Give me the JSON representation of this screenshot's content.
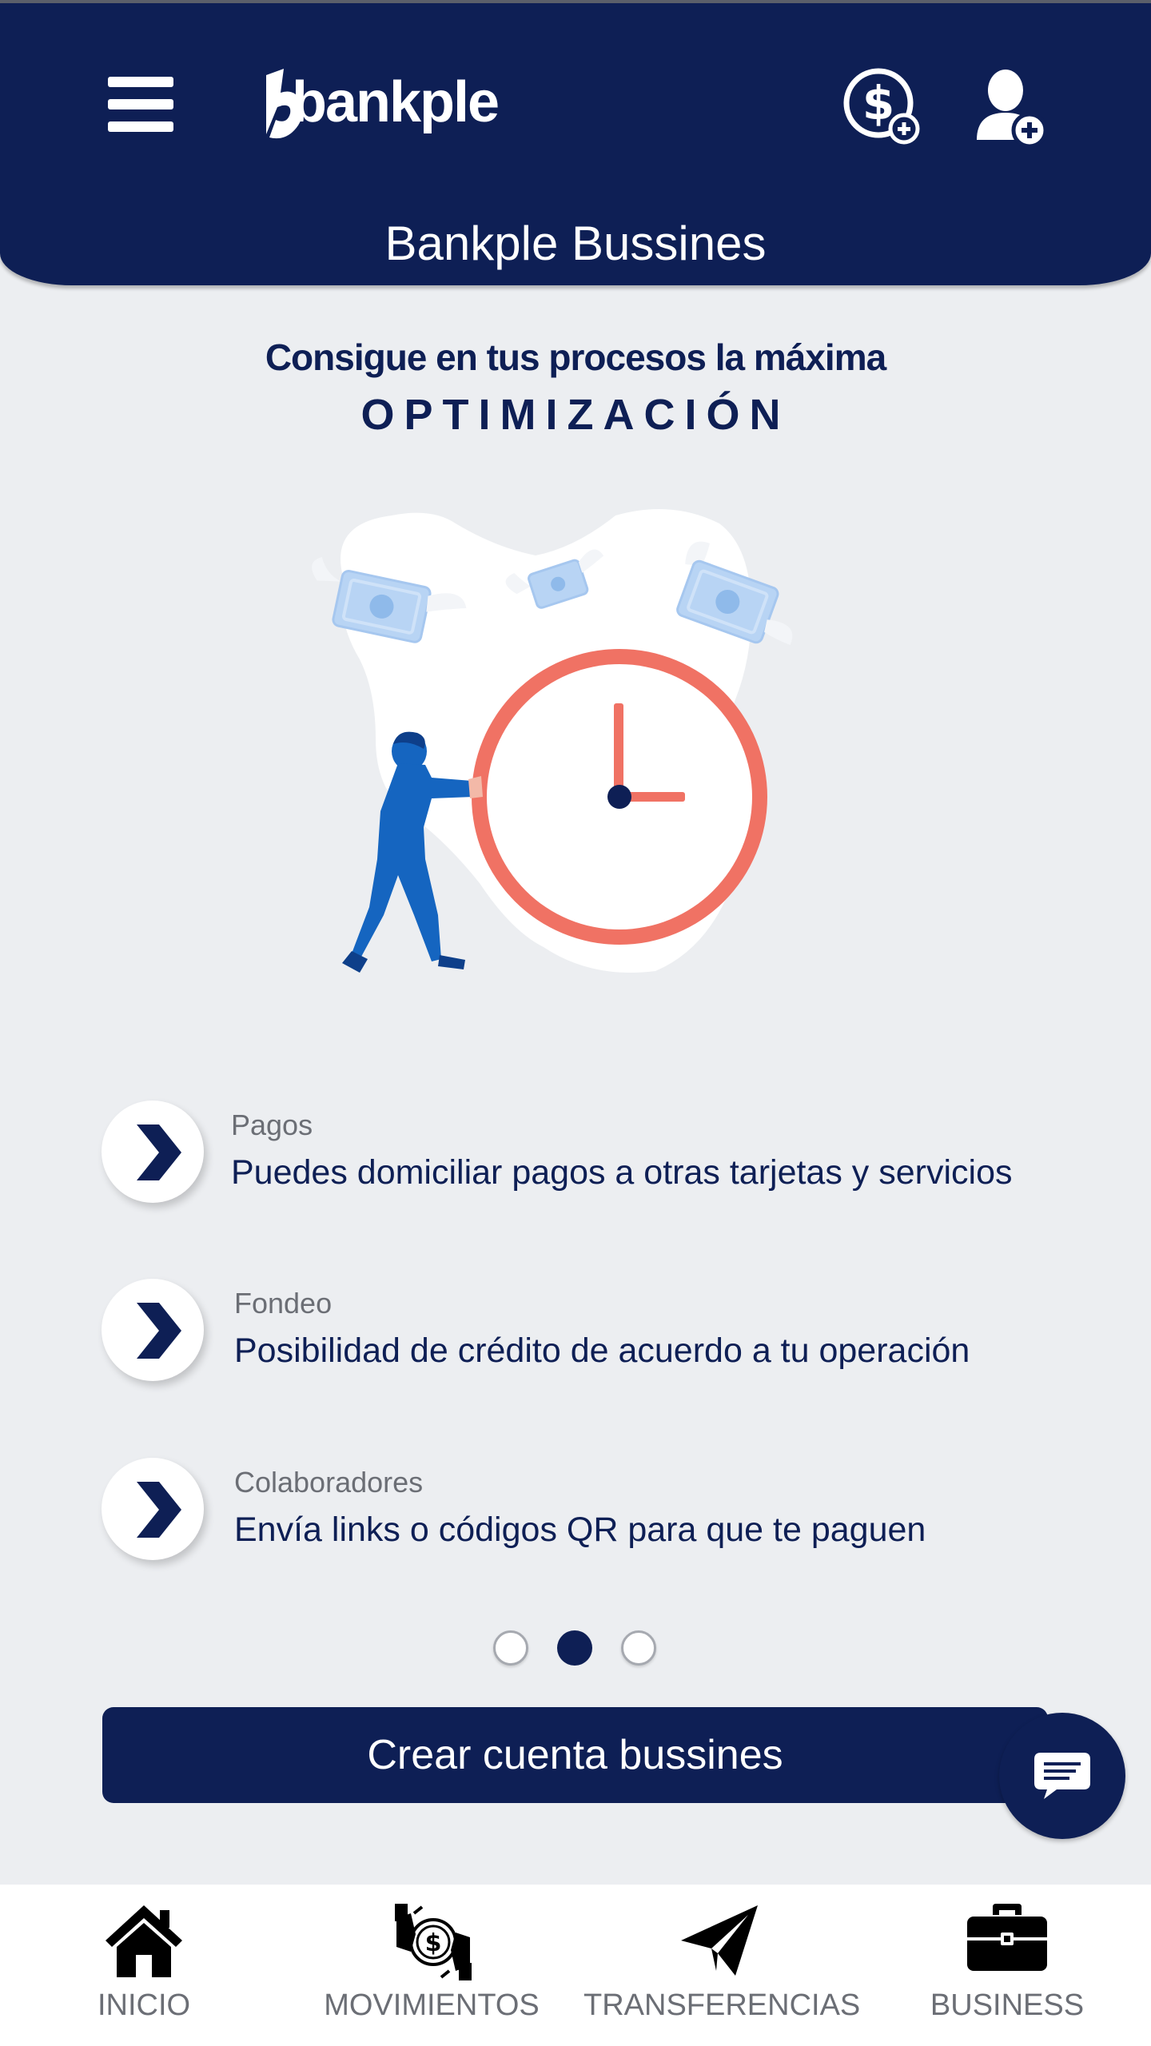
{
  "header": {
    "brand": "bankple",
    "title": "Bankple Bussines"
  },
  "hero": {
    "subtitle": "Consigue en tus procesos la máxima",
    "highlight": "OPTIMIZACIÓN"
  },
  "features": [
    {
      "title": "Pagos",
      "description": "Puedes domiciliar pagos a otras tarjetas y servicios"
    },
    {
      "title": "Fondeo",
      "description": "Posibilidad de crédito de acuerdo a tu operación"
    },
    {
      "title": "Colaboradores",
      "description": "Envía links o códigos QR para que te paguen"
    }
  ],
  "carousel": {
    "page_count": 3,
    "active_index": 1
  },
  "cta": {
    "label": "Crear cuenta bussines"
  },
  "bottom_nav": {
    "items": [
      {
        "label": "INICIO",
        "icon": "home-icon"
      },
      {
        "label": "MOVIMIENTOS",
        "icon": "movements-icon"
      },
      {
        "label": "TRANSFERENCIAS",
        "icon": "paper-plane-icon"
      },
      {
        "label": "BUSINESS",
        "icon": "briefcase-icon"
      }
    ]
  },
  "colors": {
    "primary": "#0e1f55",
    "background": "#eceef1",
    "clock": "#f07264",
    "person": "#1565c0",
    "bill": "#b8d4f4"
  }
}
